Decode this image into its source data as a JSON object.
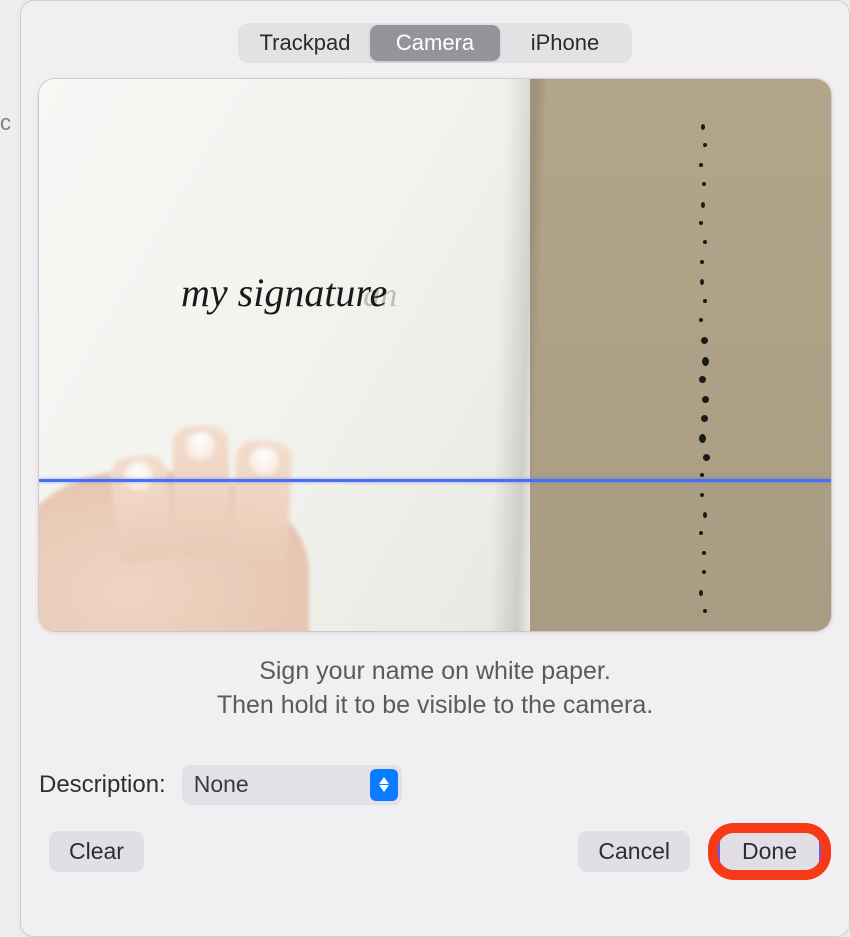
{
  "tabs": {
    "items": [
      {
        "label": "Trackpad",
        "active": false
      },
      {
        "label": "Camera",
        "active": true
      },
      {
        "label": "iPhone",
        "active": false
      }
    ]
  },
  "preview": {
    "signature_text": "my signature",
    "guide_color": "#4a6ef5"
  },
  "instructions": {
    "line1": "Sign your name on white paper.",
    "line2": "Then hold it to be visible to the camera."
  },
  "description": {
    "label": "Description:",
    "value": "None"
  },
  "buttons": {
    "clear": "Clear",
    "cancel": "Cancel",
    "done": "Done"
  },
  "highlight": {
    "target": "done-button",
    "color": "#f63a17"
  }
}
